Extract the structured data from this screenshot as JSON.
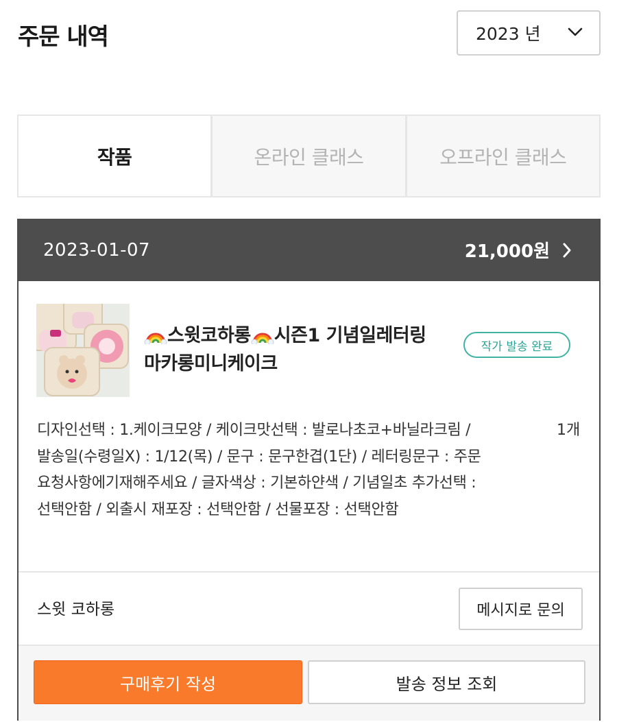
{
  "header": {
    "title": "주문 내역",
    "year_select": {
      "value": "2023 년",
      "icon": "chevron-down-icon"
    }
  },
  "tabs": [
    {
      "label": "작품",
      "active": true
    },
    {
      "label": "온라인 클래스",
      "active": false
    },
    {
      "label": "오프라인 클래스",
      "active": false
    }
  ],
  "order": {
    "date": "2023-01-07",
    "total": "21,000원",
    "product": {
      "name_part1": "스윗코하롱",
      "name_part2": "시즌1 기념일레터링 마카롱미니케이크",
      "status": "작가 발송 완료",
      "options": "디자인선택 : 1.케이크모양 / 케이크맛선택 : 발로나초코+바닐라크림 / 발송일(수령일X) : 1/12(목) / 문구 : 문구한겹(1단) / 레터링문구 : 주문요청사항에기재해주세요 / 글자색상 : 기본하얀색 / 기념일초 추가선택 : 선택안함 / 외출시 재포장 : 선택안함 / 선물포장 : 선택안함",
      "quantity": "1개"
    },
    "seller": "스윗 코하롱",
    "inquiry_button": "메시지로 문의",
    "review_button": "구매후기 작성",
    "shipping_button": "발송 정보 조회"
  },
  "colors": {
    "accent_orange": "#fa7a2c",
    "status_teal": "#2aa595",
    "header_dark": "#4d4d4d"
  }
}
